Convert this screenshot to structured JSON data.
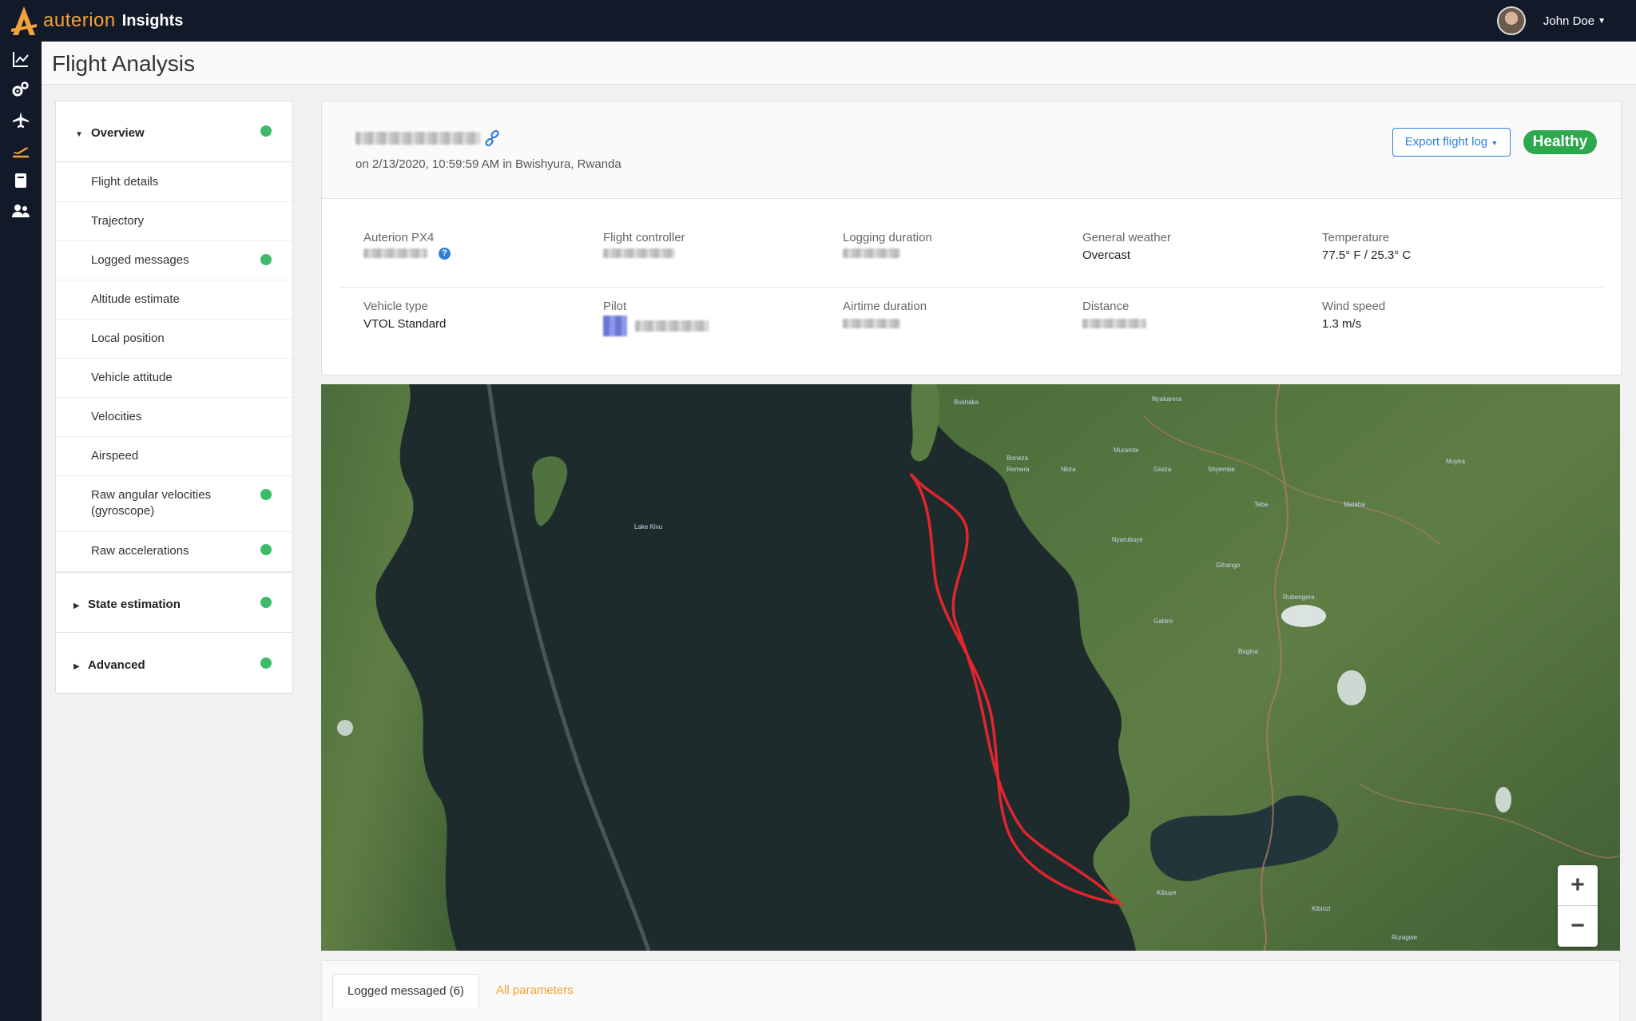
{
  "app": {
    "brand": "auterion",
    "product": "Insights",
    "user_name": "John Doe"
  },
  "page": {
    "title": "Flight Analysis"
  },
  "sidebar": {
    "sections": [
      {
        "label": "Overview",
        "expanded": true,
        "status": "green"
      },
      {
        "label": "State estimation",
        "expanded": false,
        "status": "green"
      },
      {
        "label": "Advanced",
        "expanded": false,
        "status": "green"
      }
    ],
    "overview_items": [
      {
        "label": "Flight details",
        "status": null
      },
      {
        "label": "Trajectory",
        "status": null
      },
      {
        "label": "Logged messages",
        "status": "green"
      },
      {
        "label": "Altitude estimate",
        "status": null
      },
      {
        "label": "Local position",
        "status": null
      },
      {
        "label": "Vehicle attitude",
        "status": null
      },
      {
        "label": "Velocities",
        "status": null
      },
      {
        "label": "Airspeed",
        "status": null
      },
      {
        "label": "Raw angular velocities (gyroscope)",
        "status": "green"
      },
      {
        "label": "Raw accelerations",
        "status": "green"
      }
    ]
  },
  "flight": {
    "date_location": "on 2/13/2020, 10:59:59 AM in Bwishyura, Rwanda",
    "export_label": "Export flight log",
    "health_label": "Healthy",
    "fields": {
      "autopilot_label": "Auterion PX4",
      "flight_controller_label": "Flight controller",
      "logging_duration_label": "Logging duration",
      "general_weather_label": "General weather",
      "general_weather_value": "Overcast",
      "temperature_label": "Temperature",
      "temperature_value": "77.5° F / 25.3° C",
      "vehicle_type_label": "Vehicle type",
      "vehicle_type_value": "VTOL Standard",
      "pilot_label": "Pilot",
      "airtime_duration_label": "Airtime duration",
      "distance_label": "Distance",
      "wind_speed_label": "Wind speed",
      "wind_speed_value": "1.3 m/s"
    }
  },
  "map": {
    "labels": {
      "lake": "Lake Kivu",
      "bushaka": "Bushaka",
      "nyakarera": "Nyakarera",
      "murambi": "Murambi",
      "boneza": "Boneza",
      "remera": "Remera",
      "nkira": "Nkira",
      "gisiza": "Gisiza",
      "shyembe": "Shyembe",
      "muyira": "Muyira",
      "nyarubuye": "Nyarubuye",
      "mataba": "Mataba",
      "teba": "Teba",
      "gihango": "Gihango",
      "gabiro": "Gabiro",
      "rubengera": "Rubengera",
      "bugina": "Bugina",
      "kibuye": "Kibuye",
      "kibirizi": "Kibirizi",
      "rwagwe": "Ruragwe"
    },
    "zoom_in": "+",
    "zoom_out": "−"
  },
  "tabs": [
    {
      "label": "Logged messaged (6)",
      "active": true
    },
    {
      "label": "All parameters",
      "active": false
    }
  ],
  "colors": {
    "topbar": "#121a2a",
    "accent_orange": "#f2a23a",
    "link_blue": "#2f7fd8",
    "status_green": "#3dbb6b",
    "healthy_green": "#2da84e",
    "trajectory_red": "#e3252d"
  }
}
